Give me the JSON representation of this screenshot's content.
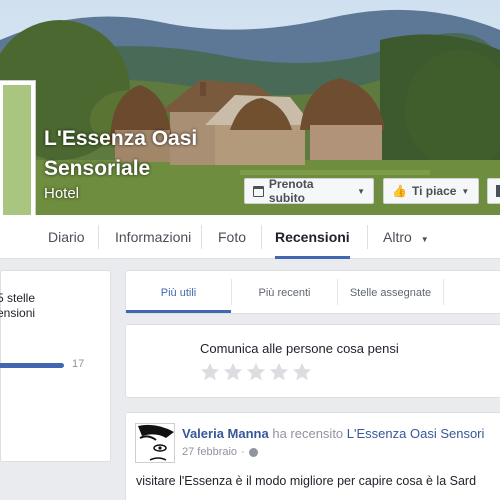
{
  "page": {
    "name": "L'Essenza Oasi Sensoriale",
    "category": "Hotel"
  },
  "actions": {
    "book_label": "Prenota subito",
    "like_label": "Ti piace"
  },
  "tabs": [
    {
      "label": "Diario"
    },
    {
      "label": "Informazioni"
    },
    {
      "label": "Foto"
    },
    {
      "label": "Recensioni",
      "active": true
    },
    {
      "label": "Altro"
    }
  ],
  "rating_summary": {
    "stars_line": "5 stelle",
    "reviews_line": "ensioni",
    "bar_count": "17",
    "bar_fraction": 1.0
  },
  "subtabs": [
    {
      "label": "Più utili",
      "active": true
    },
    {
      "label": "Più recenti"
    },
    {
      "label": "Stelle assegnate"
    }
  ],
  "composer": {
    "prompt": "Comunica alle persone cosa pensi",
    "star_count": 5
  },
  "review": {
    "author": "Valeria Manna",
    "action": "ha recensito",
    "target": "L'Essenza Oasi Sensori",
    "date": "27 febbraio",
    "separator": "·",
    "text": "visitare l'Essenza è il modo migliore per capire cosa è la Sard"
  },
  "colors": {
    "accent": "#4267b2",
    "link": "#365899",
    "star_empty": "#dcdde1",
    "profile_fill": "#a9c580"
  },
  "icons": {
    "book": "calendar-icon",
    "like": "thumbs-up-icon",
    "more": "caret-down-icon",
    "privacy": "globe-icon",
    "rating": "star-icon"
  }
}
